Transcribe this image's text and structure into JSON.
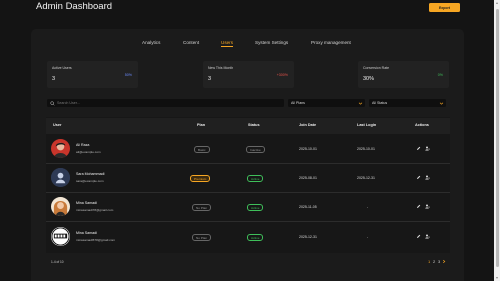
{
  "header": {
    "title": "Admin Dashboard",
    "export_label": "Export"
  },
  "tabs": [
    "Analytics",
    "Content",
    "Users",
    "System Settings",
    "Proxy management"
  ],
  "active_tab": "Users",
  "stats": [
    {
      "label": "Active Users",
      "value": "3",
      "change": "50%",
      "change_color": "#6b8cff"
    },
    {
      "label": "New This Month",
      "value": "3",
      "change": "+300%",
      "change_color": "#e8524a"
    },
    {
      "label": "Conversion Rate",
      "value": "30%",
      "change": "0%",
      "change_color": "#3fbf5a"
    }
  ],
  "filters": {
    "search_placeholder": "Search User...",
    "plan_select": "All Plans",
    "status_select": "All Status"
  },
  "table": {
    "columns": [
      "User",
      "Plan",
      "Status",
      "Join Date",
      "Last Login",
      "Actions"
    ],
    "rows": [
      {
        "name": "Ali Raza",
        "email": "ali@example.com",
        "plan": "Basic",
        "status": "Inactive",
        "join": "2025-10-01",
        "last_login": "2025-10-01"
      },
      {
        "name": "Sara Mohammadi",
        "email": "sara@example.com",
        "plan": "Premium",
        "status": "Active",
        "join": "2025-08-01",
        "last_login": "2025-12-31"
      },
      {
        "name": "Mina Samadi",
        "email": "minasamadi78@gmail.com",
        "plan": "No Plan",
        "status": "Active",
        "join": "2025-11-05",
        "last_login": "-"
      },
      {
        "name": "Mina Samadi",
        "email": "minasamadi578@gmail.com",
        "plan": "No Plan",
        "status": "Active",
        "join": "2025-12-31",
        "last_login": "-"
      }
    ]
  },
  "pagination": {
    "count_text": "1-4 of 10",
    "pages": [
      "1",
      "2",
      "3"
    ],
    "current": "1"
  },
  "colors": {
    "accent": "#f6a623",
    "active_green": "#3fbf5a",
    "premium_orange": "#f6a623"
  }
}
